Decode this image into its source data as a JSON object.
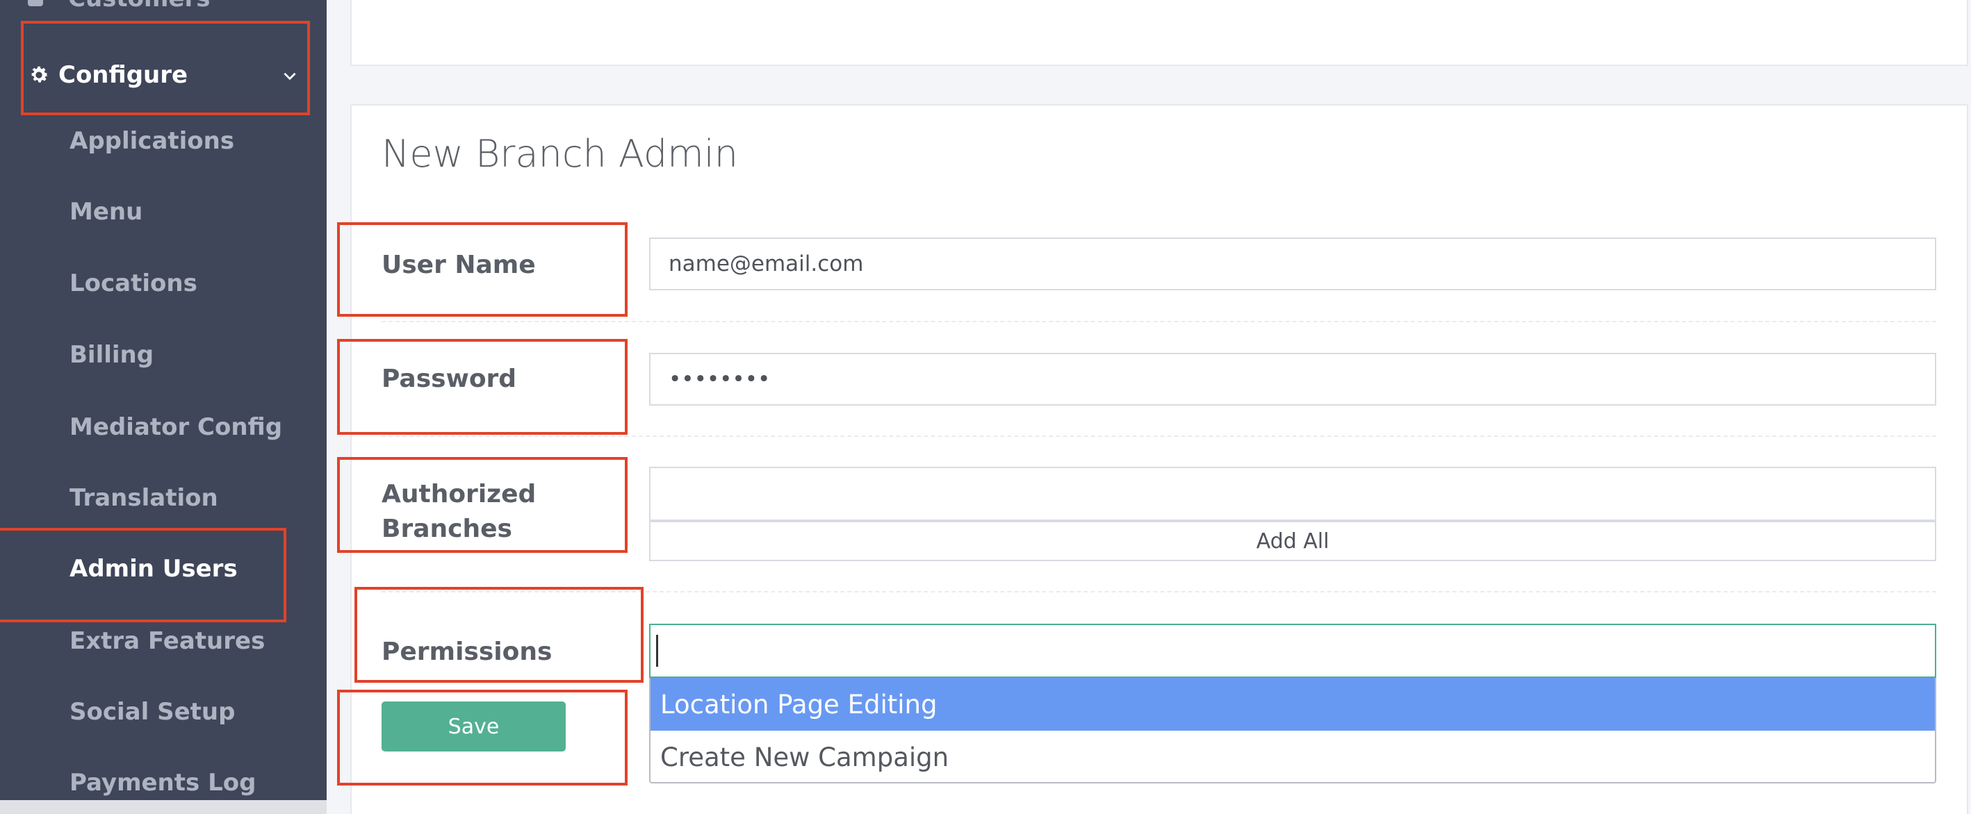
{
  "sidebar": {
    "customers_label": "Customers",
    "configure_label": "Configure",
    "items": [
      {
        "label": "Applications"
      },
      {
        "label": "Menu"
      },
      {
        "label": "Locations"
      },
      {
        "label": "Billing"
      },
      {
        "label": "Mediator Config"
      },
      {
        "label": "Translation"
      },
      {
        "label": "Admin Users"
      },
      {
        "label": "Extra Features"
      },
      {
        "label": "Social Setup"
      },
      {
        "label": "Payments Log"
      }
    ],
    "active_item": "Admin Users"
  },
  "form": {
    "title": "New Branch Admin",
    "username_label": "User Name",
    "username_value": "name@email.com",
    "password_label": "Password",
    "password_value": "••••••••",
    "branches_label_line1": "Authorized",
    "branches_label_line2": "Branches",
    "add_all_label": "Add All",
    "permissions_label": "Permissions",
    "permission_options": [
      "Location Page Editing",
      "Create New Campaign"
    ],
    "save_label": "Save"
  },
  "colors": {
    "sidebar_bg": "#3f4659",
    "annotation_red": "#e0432a",
    "save_green": "#53b092",
    "selected_blue": "#6899f2"
  }
}
